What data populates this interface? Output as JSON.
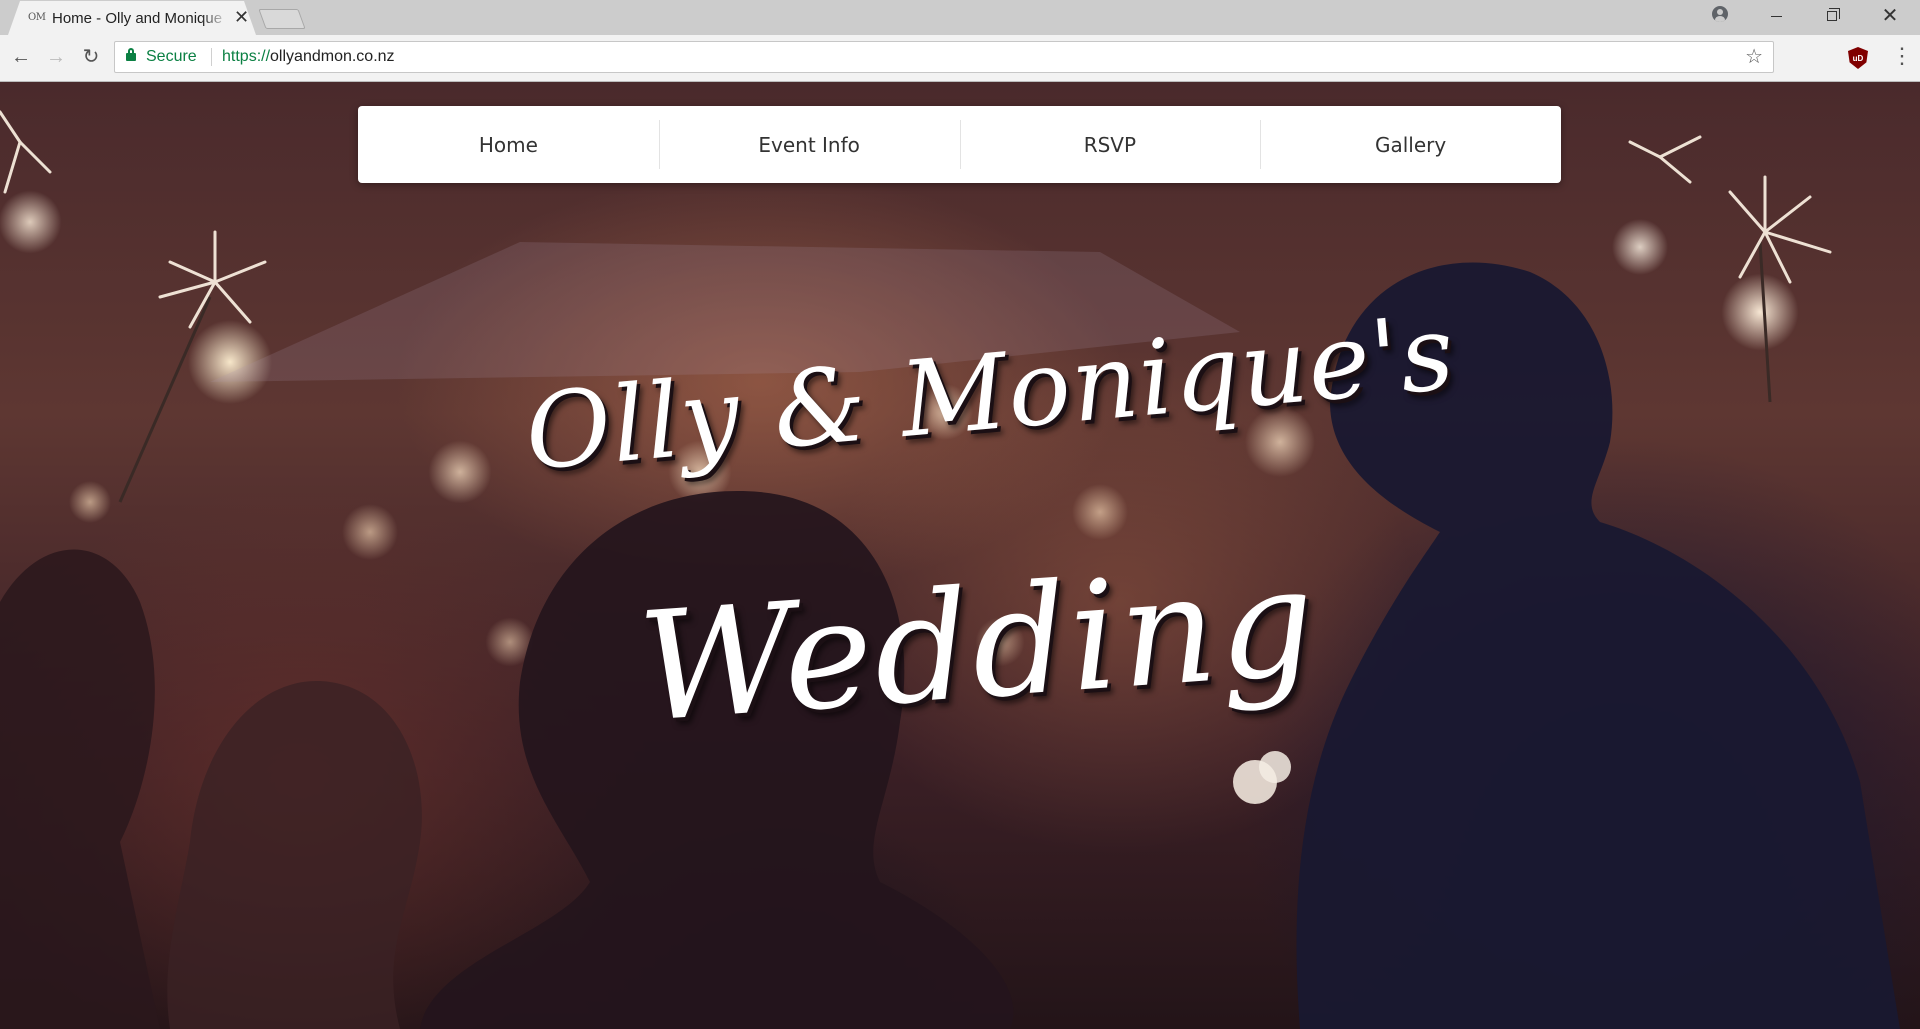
{
  "browser": {
    "tab": {
      "favicon_text": "OM",
      "title": "Home - Olly and Monique",
      "close_glyph": "✕"
    },
    "address_bar": {
      "secure_label": "Secure",
      "url_scheme": "https://",
      "url_host": "ollyandmon.co.nz"
    },
    "icons": {
      "back": "←",
      "forward": "→",
      "reload": "↻",
      "star": "☆",
      "menu": "⋮",
      "extension": "uD"
    }
  },
  "site": {
    "nav": [
      {
        "label": "Home"
      },
      {
        "label": "Event Info"
      },
      {
        "label": "RSVP"
      },
      {
        "label": "Gallery"
      }
    ],
    "hero": {
      "line1": "Olly & Monique's",
      "line2": "Wedding"
    }
  },
  "colors": {
    "secure_green": "#0b8043",
    "nav_text": "#333333",
    "hero_text": "#ffffff",
    "ublock_red": "#800000"
  }
}
